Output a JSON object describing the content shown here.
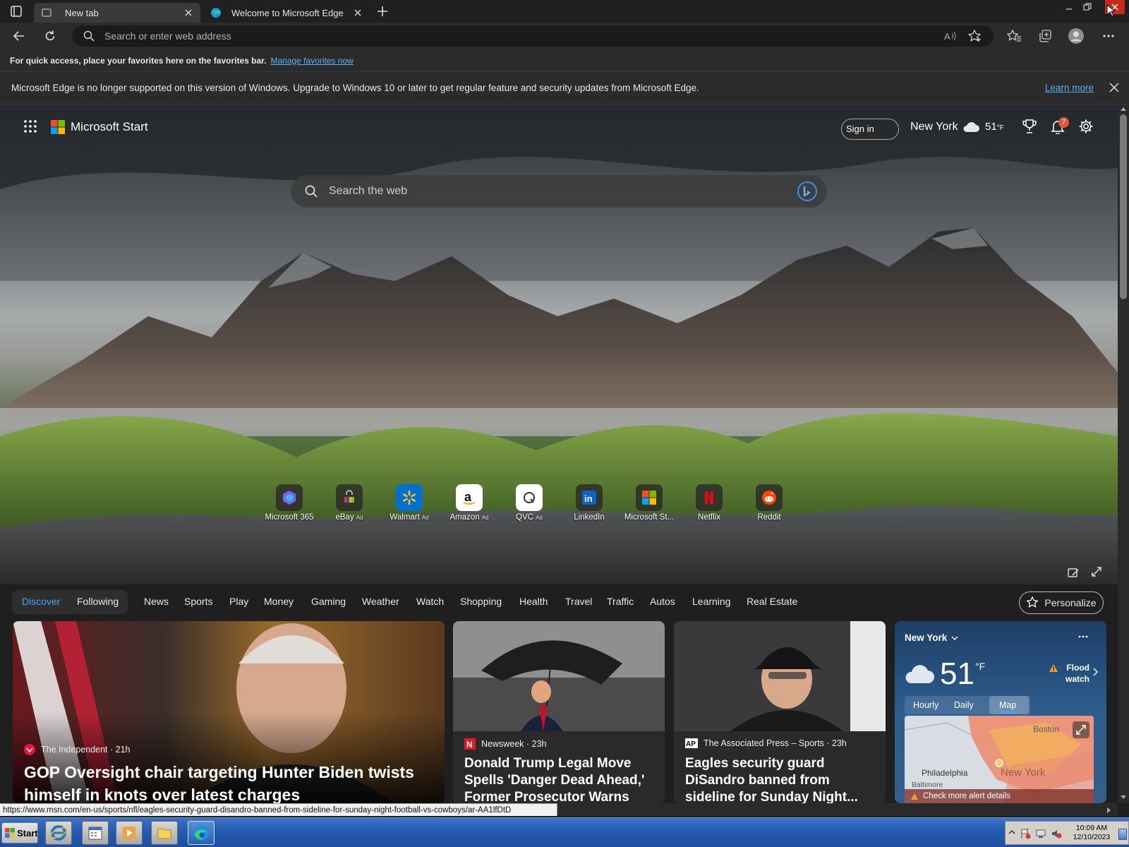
{
  "browser": {
    "tabs": [
      {
        "label": "New tab",
        "icon": "newtab-icon"
      },
      {
        "label": "Welcome to Microsoft Edge",
        "icon": "edge-icon"
      }
    ],
    "address_placeholder": "Search or enter web address",
    "favorites_hint": "For quick access, place your favorites here on the favorites bar.",
    "favorites_link": "Manage favorites now",
    "warning_text": "Microsoft Edge is no longer supported on this version of Windows. Upgrade to Windows 10 or later to get regular feature and security updates from Microsoft Edge.",
    "warning_link": "Learn more"
  },
  "start": {
    "brand": "Microsoft Start",
    "sign_in": "Sign in",
    "location": "New York",
    "temp": "51",
    "temp_unit": "°F",
    "notification_count": "7",
    "search_placeholder": "Search the web",
    "quick_links": [
      {
        "label": "Microsoft 365",
        "ad": "",
        "icon": "microsoft365-icon"
      },
      {
        "label": "eBay",
        "ad": "Ad",
        "icon": "ebay-icon"
      },
      {
        "label": "Walmart",
        "ad": "Ad",
        "icon": "walmart-icon"
      },
      {
        "label": "Amazon",
        "ad": "Ad",
        "icon": "amazon-icon"
      },
      {
        "label": "QVC",
        "ad": "Ad",
        "icon": "qvc-icon"
      },
      {
        "label": "LinkedIn",
        "ad": "",
        "icon": "linkedin-icon"
      },
      {
        "label": "Microsoft St...",
        "ad": "",
        "icon": "microsoft-store-icon"
      },
      {
        "label": "Netflix",
        "ad": "",
        "icon": "netflix-icon"
      },
      {
        "label": "Reddit",
        "ad": "",
        "icon": "reddit-icon"
      }
    ]
  },
  "nav": {
    "items": [
      "Discover",
      "Following",
      "News",
      "Sports",
      "Play",
      "Money",
      "Gaming",
      "Weather",
      "Watch",
      "Shopping",
      "Health",
      "Travel",
      "Traffic",
      "Autos",
      "Learning",
      "Real Estate"
    ],
    "personalize": "Personalize",
    "active_color": "#4aa3ff"
  },
  "cards": [
    {
      "source": "The Independent · 21h",
      "headline": "GOP Oversight chair targeting Hunter Biden twists himself in knots over latest charges"
    },
    {
      "source": "Newsweek · 23h",
      "headline": "Donald Trump Legal Move Spells 'Danger Dead Ahead,' Former Prosecutor Warns"
    },
    {
      "source": "The Associated Press – Sports · 23h",
      "headline": "Eagles security guard DiSandro banned from sideline for Sunday Night..."
    }
  ],
  "weather_card": {
    "location": "New York",
    "temp": "51",
    "unit": "°F",
    "alert": "Flood watch",
    "tabs": [
      "Hourly",
      "Daily",
      "Map"
    ],
    "map_labels": [
      "Boston",
      "Philadelphia",
      "Baltimore",
      "New York"
    ],
    "alert_link": "Check more alert details"
  },
  "status_url": "https://www.msn.com/en-us/sports/nfl/eagles-security-guard-disandro-banned-from-sideline-for-sunday-night-football-vs-cowboys/ar-AA1lfDtD",
  "taskbar": {
    "start": "Start",
    "time": "10:09 AM",
    "date": "12/10/2023"
  }
}
